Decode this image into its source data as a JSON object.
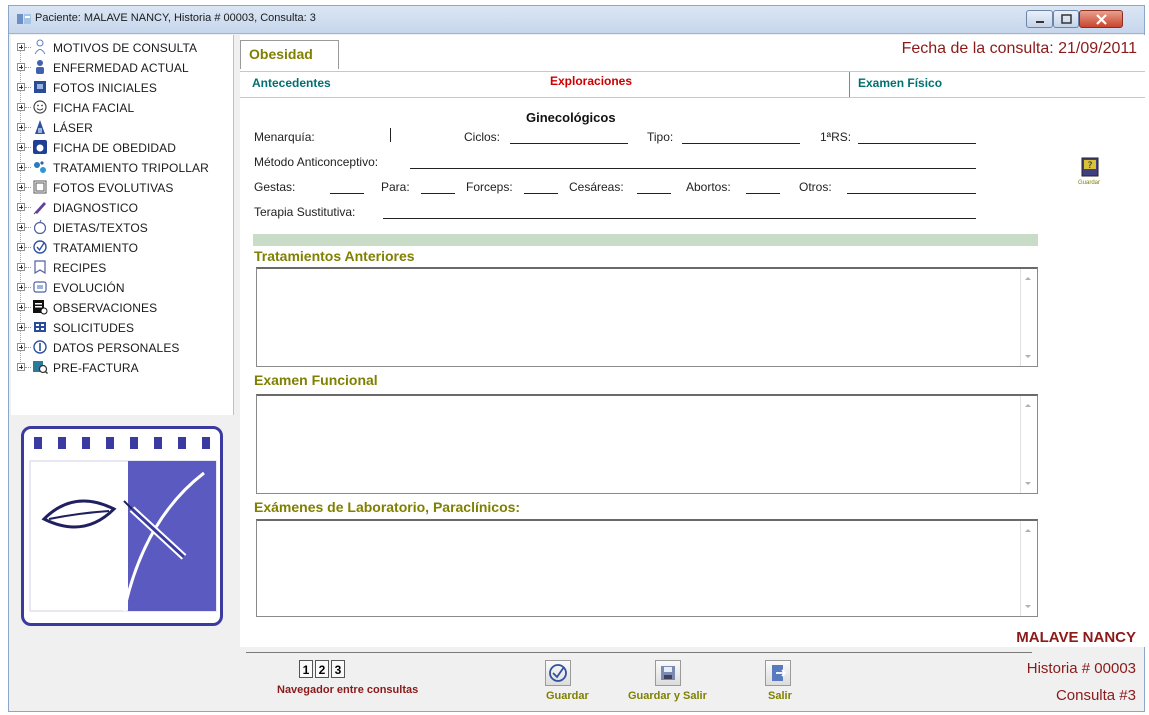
{
  "window": {
    "title": "Paciente: MALAVE  NANCY, Historia # 00003, Consulta: 3"
  },
  "tree": {
    "items": [
      {
        "label": "MOTIVOS DE CONSULTA",
        "icon": "people-icon"
      },
      {
        "label": "ENFERMEDAD ACTUAL",
        "icon": "person-icon"
      },
      {
        "label": "FOTOS INICIALES",
        "icon": "photo-icon"
      },
      {
        "label": "FICHA FACIAL",
        "icon": "smiley-icon"
      },
      {
        "label": "LÁSER",
        "icon": "laser-icon"
      },
      {
        "label": "FICHA DE OBEDIDAD",
        "icon": "scale-icon"
      },
      {
        "label": "TRATAMIENTO TRIPOLLAR",
        "icon": "tripollar-icon"
      },
      {
        "label": "FOTOS EVOLUTIVAS",
        "icon": "photos-icon"
      },
      {
        "label": "DIAGNOSTICO",
        "icon": "pen-icon"
      },
      {
        "label": "DIETAS/TEXTOS",
        "icon": "apple-icon"
      },
      {
        "label": "TRATAMIENTO",
        "icon": "check-circle-icon"
      },
      {
        "label": "RECIPES",
        "icon": "recipe-icon"
      },
      {
        "label": "EVOLUCIÓN",
        "icon": "evolution-icon"
      },
      {
        "label": "OBSERVACIONES",
        "icon": "observations-icon"
      },
      {
        "label": "SOLICITUDES",
        "icon": "requests-icon"
      },
      {
        "label": "DATOS PERSONALES",
        "icon": "info-icon"
      },
      {
        "label": "PRE-FACTURA",
        "icon": "invoice-search-icon"
      }
    ]
  },
  "main": {
    "tab": "Obesidad",
    "fecha": "Fecha de la consulta: 21/09/2011",
    "subtabs": {
      "antecedentes": "Antecedentes",
      "exploraciones": "Exploraciones",
      "examen_fisico": "Examen Físico"
    },
    "ginecologicos": {
      "heading": "Ginecológicos",
      "menarquia": "Menarquía:",
      "ciclos": "Ciclos:",
      "tipo": "Tipo:",
      "rs": "1ªRS:",
      "metodo": "Método Anticonceptivo:",
      "gestas": "Gestas:",
      "para": "Para:",
      "forceps": "Forceps:",
      "cesareas": "Cesáreas:",
      "abortos": "Abortos:",
      "otros": "Otros:",
      "terapia": "Terapia Sustitutiva:"
    },
    "sections": {
      "tratamientos": "Tratamientos Anteriores",
      "examen_funcional": "Examen Funcional",
      "examenes_lab": "Exámenes de Laboratorio, Paraclínicos:"
    },
    "side_button_label": "Guardar"
  },
  "footer": {
    "patient_name": "MALAVE NANCY",
    "historia": "Historia # 00003",
    "consulta": "Consulta #3",
    "nav_buttons": [
      "1",
      "2",
      "3"
    ],
    "nav_label": "Navegador entre consultas",
    "guardar": "Guardar",
    "guardar_salir": "Guardar y Salir",
    "salir": "Salir"
  },
  "colors": {
    "olive": "#808000",
    "dark_red": "#8b1a1a",
    "teal": "#007070",
    "red": "#cc0000",
    "logo_blue": "#3a3aa0"
  }
}
